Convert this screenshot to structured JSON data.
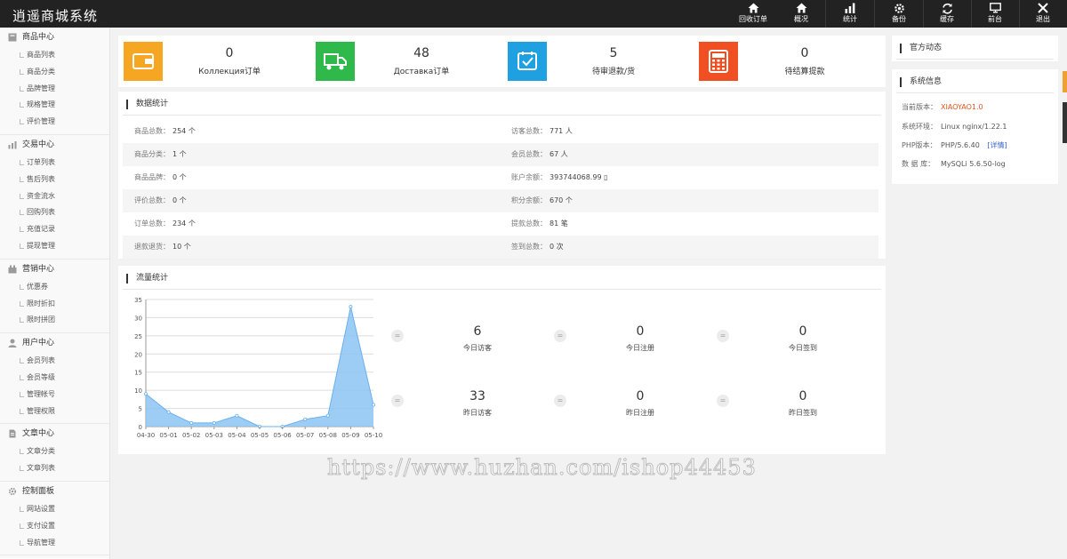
{
  "app_title": "逍遥商城系统",
  "topbar": {
    "buttons": [
      {
        "label": "回收订单",
        "icon": "home-icon"
      },
      {
        "label": "概况",
        "icon": "home-icon"
      },
      {
        "label": "统计",
        "icon": "bar-chart-icon"
      },
      {
        "label": "备份",
        "icon": "gear-icon"
      },
      {
        "label": "缓存",
        "icon": "refresh-icon"
      },
      {
        "label": "前台",
        "icon": "monitor-icon"
      },
      {
        "label": "退出",
        "icon": "close-icon"
      }
    ]
  },
  "sidebar": {
    "groups": [
      {
        "title": "商品中心",
        "icon": "box-icon",
        "items": [
          "商品列表",
          "商品分类",
          "品牌管理",
          "规格管理",
          "评价管理"
        ]
      },
      {
        "title": "交易中心",
        "icon": "bar-chart-icon",
        "items": [
          "订单列表",
          "售后列表",
          "资金流水",
          "回购列表",
          "充值记录",
          "提现管理"
        ]
      },
      {
        "title": "营销中心",
        "icon": "marketing-icon",
        "items": [
          "优惠券",
          "限时折扣",
          "限时拼团"
        ]
      },
      {
        "title": "用户中心",
        "icon": "user-icon",
        "items": [
          "会员列表",
          "会员等级",
          "管理帐号",
          "管理权限"
        ]
      },
      {
        "title": "文章中心",
        "icon": "document-icon",
        "items": [
          "文章分类",
          "文章列表"
        ]
      },
      {
        "title": "控制面板",
        "icon": "gear-icon",
        "items": [
          "网站设置",
          "支付设置",
          "导航管理"
        ]
      }
    ]
  },
  "kpis": [
    {
      "value": "0",
      "label": "Коллекция订单",
      "color": "#f5a623",
      "icon": "wallet-icon"
    },
    {
      "value": "48",
      "label": "Доставка订单",
      "color": "#2fb94a",
      "icon": "truck-icon"
    },
    {
      "value": "5",
      "label": "待审退款/货",
      "color": "#1fa0e0",
      "icon": "check-box-icon"
    },
    {
      "value": "0",
      "label": "待结算提款",
      "color": "#f04e23",
      "icon": "calculator-icon"
    }
  ],
  "data_stats": {
    "title": "数据统计",
    "rows": [
      [
        {
          "label": "商品总数：",
          "value": "254 个"
        },
        {
          "label": "访客总数：",
          "value": "771 人"
        }
      ],
      [
        {
          "label": "商品分类：",
          "value": "1 个"
        },
        {
          "label": "会员总数：",
          "value": "67 人"
        }
      ],
      [
        {
          "label": "商品品牌：",
          "value": "0 个"
        },
        {
          "label": "账户余额：",
          "value": "393744068.99 ▯"
        }
      ],
      [
        {
          "label": "评价总数：",
          "value": "0 个"
        },
        {
          "label": "积分余额：",
          "value": "670 个"
        }
      ],
      [
        {
          "label": "订单总数：",
          "value": "234 个"
        },
        {
          "label": "提款总数：",
          "value": "81 笔"
        }
      ],
      [
        {
          "label": "退款退货：",
          "value": "10 个"
        },
        {
          "label": "签到总数：",
          "value": "0 次"
        }
      ]
    ]
  },
  "traffic": {
    "title": "流量统计",
    "eq_glyph": "=",
    "stats": [
      {
        "value": "6",
        "label": "今日访客"
      },
      {
        "value": "0",
        "label": "今日注册"
      },
      {
        "value": "0",
        "label": "今日签到"
      },
      {
        "value": "33",
        "label": "昨日访客"
      },
      {
        "value": "0",
        "label": "昨日注册"
      },
      {
        "value": "0",
        "label": "昨日签到"
      }
    ]
  },
  "chart_data": {
    "type": "area",
    "x": [
      "04-30",
      "05-01",
      "05-02",
      "05-03",
      "05-04",
      "05-05",
      "05-06",
      "05-07",
      "05-08",
      "05-09",
      "05-10"
    ],
    "series": [
      {
        "values": [
          9,
          4,
          1,
          1,
          3,
          0,
          0,
          2,
          3,
          33,
          6
        ]
      }
    ],
    "ylim": [
      0,
      35
    ],
    "yticks": [
      0,
      5,
      10,
      15,
      20,
      25,
      30,
      35
    ],
    "grid": true,
    "colors": {
      "fill": "#8cc4f2",
      "line": "#6ab0ee"
    }
  },
  "right_panel": {
    "official_title": "官方动态",
    "sysinfo_title": "系统信息",
    "rows": [
      {
        "label": "当前版本：",
        "value": "XIAOYAO1.0"
      },
      {
        "label": "系统环境：",
        "value": "Linux nginx/1.22.1"
      },
      {
        "label": "PHP版本：",
        "value": "PHP/5.6.40",
        "link": "[详情]"
      },
      {
        "label": "数 据 库：",
        "value": "MySQLi 5.6.50-log"
      }
    ],
    "version_color": "#e8541e",
    "link_color": "#3366cc"
  },
  "watermark": "https://www.huzhan.com/ishop44453"
}
